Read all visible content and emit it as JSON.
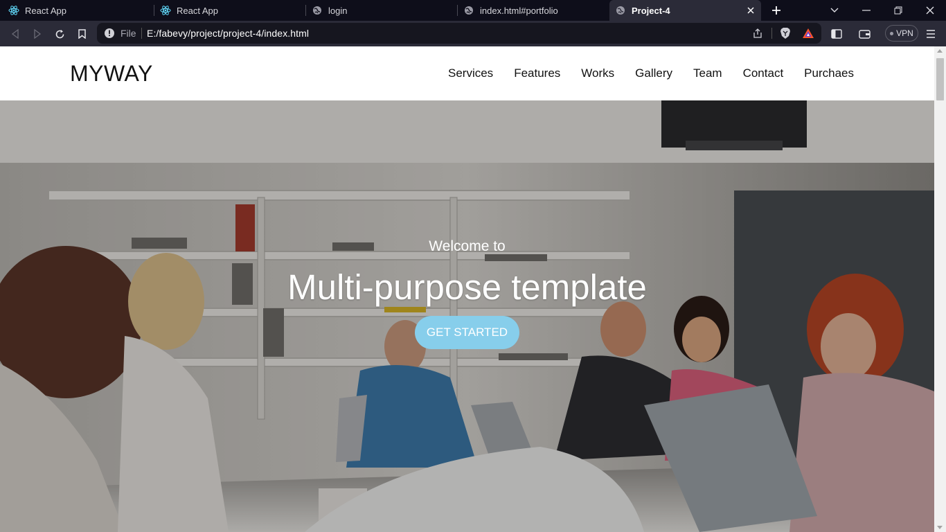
{
  "browser": {
    "tabs": [
      {
        "title": "React App",
        "icon": "react-icon"
      },
      {
        "title": "React App",
        "icon": "react-icon"
      },
      {
        "title": "login",
        "icon": "globe-icon"
      },
      {
        "title": "index.html#portfolio",
        "icon": "globe-icon"
      },
      {
        "title": "Project-4",
        "icon": "globe-icon",
        "active": true
      }
    ],
    "address": {
      "scheme_label": "File",
      "url": "E:/fabevy/project/project-4/index.html"
    },
    "vpn_label": "VPN"
  },
  "site": {
    "brand": "MYWAY",
    "nav": [
      "Services",
      "Features",
      "Works",
      "Gallery",
      "Team",
      "Contact",
      "Purchaes"
    ],
    "hero": {
      "welcome": "Welcome to",
      "headline": "Multi-purpose template",
      "cta_label": "GET STARTED"
    }
  },
  "colors": {
    "browser_bg": "#0e0e1a",
    "toolbar_bg": "#2b2b38",
    "cta_bg": "#87ceeb",
    "brave_orange": "#fb542b"
  }
}
